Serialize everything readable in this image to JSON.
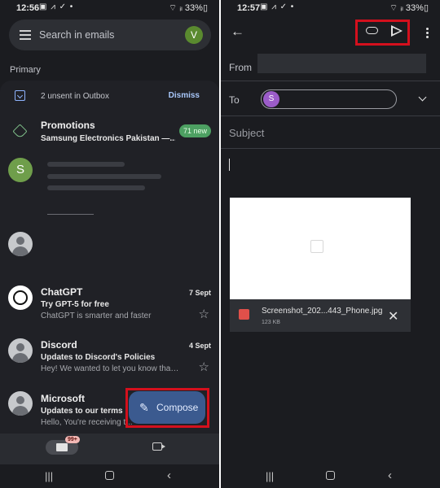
{
  "left_screen": {
    "status": {
      "time": "12:56",
      "icons": "▣ ⩘ ✓ •",
      "battery": "⌔ ᵢₗ 33%▯"
    },
    "search": {
      "placeholder": "Search in emails",
      "avatar_letter": "V"
    },
    "section_label": "Primary",
    "outbox": {
      "text": "2 unsent in Outbox",
      "action": "Dismiss"
    },
    "promotions": {
      "title": "Promotions",
      "sender": "Samsung Electronics Pakistan —...",
      "badge": "71 new"
    },
    "blurred_sender_avatar": "S",
    "emails": [
      {
        "sender": "ChatGPT",
        "date": "7 Sept",
        "subject": "Try GPT-5 for free",
        "preview": "ChatGPT is smarter and faster"
      },
      {
        "sender": "Discord",
        "date": "4 Sept",
        "subject": "Updates to Discord's Policies",
        "preview": "Hey! We wanted to let you know that we..."
      },
      {
        "sender": "Microsoft",
        "date": "",
        "subject": "Updates to our terms",
        "preview": "Hello, You're receiving t..."
      }
    ],
    "compose_label": "Compose",
    "nav_badge": "99+",
    "highlight_color": "#d4101d"
  },
  "right_screen": {
    "status": {
      "time": "12:57",
      "icons": "▣ ⩘ ✓ •",
      "battery": "⌔ ᵢₗ 33%▯"
    },
    "from_label": "From",
    "to_label": "To",
    "to_chip_letter": "S",
    "subject_placeholder": "Subject",
    "attachment": {
      "name": "Screenshot_202...443_Phone.jpg",
      "size": "123 KB"
    }
  },
  "icons": [
    "hamburger-icon",
    "outbox-icon",
    "tag-icon",
    "star-icon",
    "pencil-icon",
    "mail-icon",
    "video-icon",
    "back-arrow-icon",
    "attach-icon",
    "send-icon",
    "more-vert-icon",
    "chevron-down-icon",
    "image-icon",
    "close-icon"
  ]
}
